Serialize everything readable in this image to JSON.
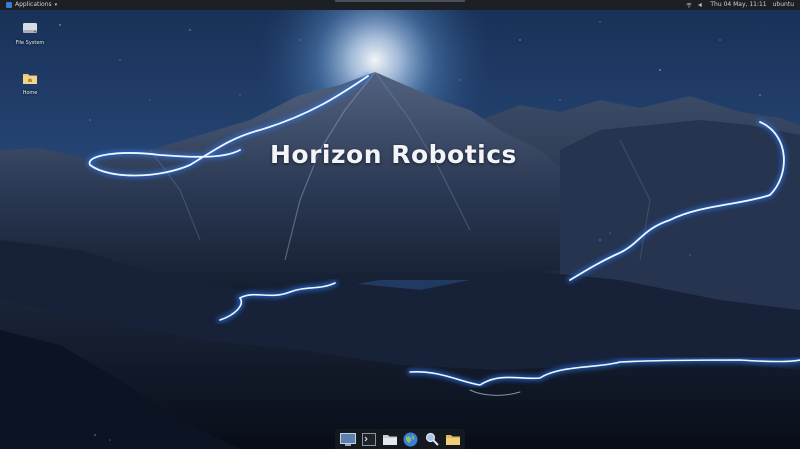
{
  "topbar": {
    "apps_label": "Applications",
    "clock": "Thu 04 May, 11:11",
    "user": "ubuntu",
    "icons": [
      "apps-icon",
      "wifi-icon",
      "volume-icon"
    ]
  },
  "desktop": {
    "icons": [
      {
        "name": "file-system-icon",
        "label": "File System"
      },
      {
        "name": "home-folder-icon",
        "label": "Home"
      }
    ],
    "wallpaper_title": "Horizon Robotics",
    "colors": {
      "sky_top": "#1b2f55",
      "glow": "#bfe0ff",
      "mountain": "#34435e",
      "trail": "#e9f5ff",
      "trail_glow": "#2a7dff"
    }
  },
  "dock": {
    "items": [
      {
        "name": "show-desktop-icon",
        "label": "Show Desktop"
      },
      {
        "name": "terminal-icon",
        "label": "Terminal"
      },
      {
        "name": "files-icon",
        "label": "Files"
      },
      {
        "name": "browser-icon",
        "label": "Web Browser"
      },
      {
        "name": "search-icon",
        "label": "Search"
      },
      {
        "name": "folder-icon",
        "label": "Folder"
      }
    ]
  }
}
